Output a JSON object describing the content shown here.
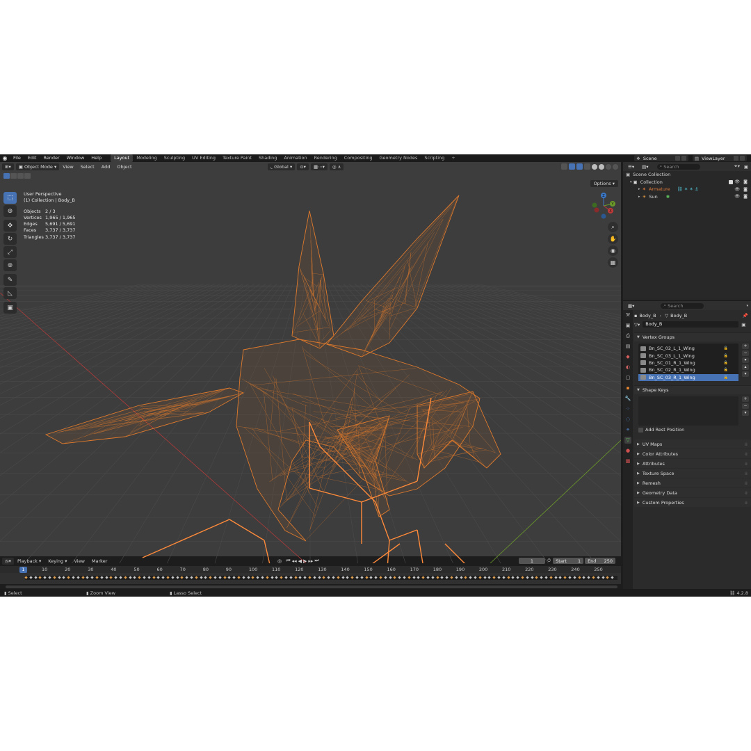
{
  "topbar": {
    "menus": [
      "File",
      "Edit",
      "Render",
      "Window",
      "Help"
    ],
    "workspaces": [
      "Layout",
      "Modeling",
      "Sculpting",
      "UV Editing",
      "Texture Paint",
      "Shading",
      "Animation",
      "Rendering",
      "Compositing",
      "Geometry Nodes",
      "Scripting"
    ],
    "active_workspace": "Layout",
    "add_workspace": "+",
    "scene": "Scene",
    "view_layer": "ViewLayer"
  },
  "viewport": {
    "mode": "Object Mode",
    "menus": [
      "View",
      "Select",
      "Add",
      "Object"
    ],
    "orientation": "Global",
    "options": "Options",
    "overlay": {
      "view_name": "User Perspective",
      "collection": "(1) Collection | Body_B",
      "stats": [
        {
          "label": "Objects",
          "value": "2 / 3"
        },
        {
          "label": "Vertices",
          "value": "1,965 / 1,965"
        },
        {
          "label": "Edges",
          "value": "5,691 / 5,691"
        },
        {
          "label": "Faces",
          "value": "3,737 / 3,737"
        },
        {
          "label": "Triangles",
          "value": "3,737 / 3,737"
        }
      ]
    },
    "gizmo_axes": {
      "x": "X",
      "y": "Y",
      "z": "Z"
    },
    "colors": {
      "background": "#3d3d3d",
      "wire": "#e07a2c",
      "bone": "#ff8a3a",
      "axis_x": "#c03a3a",
      "axis_y": "#6b9a2a"
    }
  },
  "timeline": {
    "menus": [
      "Playback",
      "Keying",
      "View",
      "Marker"
    ],
    "current_frame": "1",
    "start_label": "Start",
    "start": "1",
    "end_label": "End",
    "end": "250",
    "ticks": [
      "10",
      "20",
      "30",
      "40",
      "50",
      "60",
      "70",
      "80",
      "90",
      "100",
      "110",
      "120",
      "130",
      "140",
      "150",
      "160",
      "170",
      "180",
      "190",
      "200",
      "210",
      "220",
      "230",
      "240",
      "250"
    ],
    "cursor": "1"
  },
  "statusbar": {
    "select": "Select",
    "zoom": "Zoom View",
    "lasso": "Lasso Select",
    "version": "4.2.8"
  },
  "outliner": {
    "search_placeholder": "Search",
    "scene_collection": "Scene Collection",
    "collection": "Collection",
    "items": [
      {
        "name": "Armature",
        "color": "#e07a3a"
      },
      {
        "name": "Sun",
        "color": "#d8d8d8"
      }
    ]
  },
  "properties": {
    "search_placeholder": "Search",
    "breadcrumb_object": "Body_B",
    "breadcrumb_mesh": "Body_B",
    "mesh_name": "Body_B",
    "vertex_groups_title": "Vertex Groups",
    "vertex_groups": [
      "Bn_SC_02_L_1_Wing",
      "Bn_SC_03_L_1_Wing",
      "Bn_SC_01_R_1_Wing",
      "Bn_SC_02_R_1_Wing",
      "Bn_SC_03_R_1_Wing"
    ],
    "selected_vertex_group": "Bn_SC_03_R_1_Wing",
    "shape_keys_title": "Shape Keys",
    "add_rest_position": "Add Rest Position",
    "panels": [
      "UV Maps",
      "Color Attributes",
      "Attributes",
      "Texture Space",
      "Remesh",
      "Geometry Data",
      "Custom Properties"
    ]
  }
}
